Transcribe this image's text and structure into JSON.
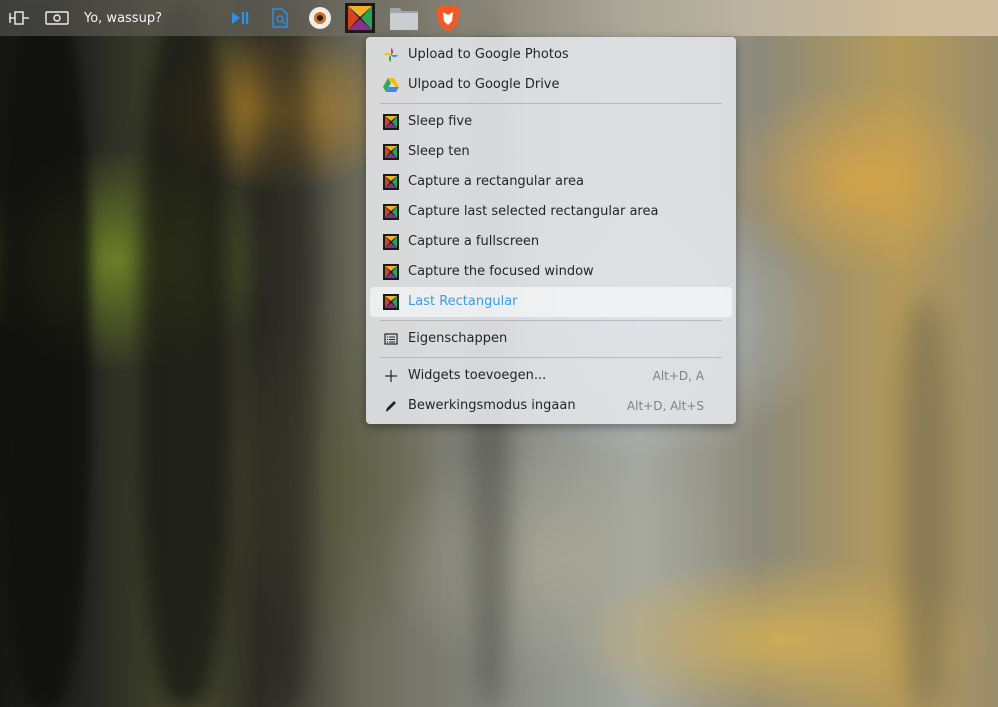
{
  "panel": {
    "status_text": "Yo, wassup?",
    "icons": [
      "panel-pin-icon",
      "screenshot-icon",
      "media-play-pause-icon",
      "document-search-icon",
      "eye-icon",
      "flameshot-icon",
      "folder-icon",
      "brave-browser-icon"
    ]
  },
  "menu": {
    "cloud": [
      {
        "label": "Upload to Google Photos",
        "icon": "google-photos-icon"
      },
      {
        "label": "Ulpoad to Google Drive",
        "icon": "google-drive-icon"
      }
    ],
    "actions": [
      {
        "label": "Sleep five"
      },
      {
        "label": "Sleep ten"
      },
      {
        "label": "Capture a rectangular area"
      },
      {
        "label": "Capture last selected rectangular area"
      },
      {
        "label": "Capture a fullscreen"
      },
      {
        "label": "Capture the focused window"
      },
      {
        "label": "Last Rectangular",
        "highlighted": true
      }
    ],
    "properties": {
      "label": "Eigenschappen",
      "icon": "properties-icon"
    },
    "widgets": {
      "label": "Widgets toevoegen...",
      "shortcut": "Alt+D, A",
      "icon": "plus-icon"
    },
    "edit_mode": {
      "label": "Bewerkingsmodus ingaan",
      "shortcut": "Alt+D, Alt+S",
      "icon": "pencil-icon"
    }
  },
  "colors": {
    "highlight_text": "#3a9de0",
    "menu_bg": "#e2e4e8"
  }
}
